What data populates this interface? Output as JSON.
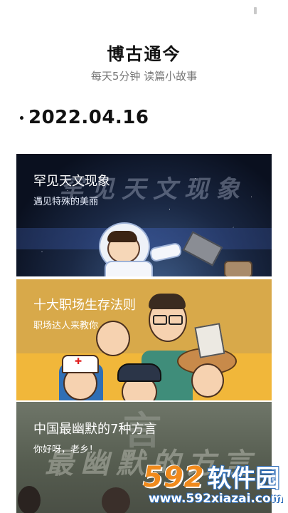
{
  "header": {
    "title": "博古通今",
    "subtitle": "每天5分钟 读篇小故事"
  },
  "date": "2022.04.16",
  "cards": [
    {
      "title": "罕见天文现象",
      "subtitle": "遇见特殊的美丽",
      "bg_text": "罕见天文现象",
      "color": "#1a2844"
    },
    {
      "title": "十大职场生存法则",
      "subtitle": "职场达人来教你",
      "color": "#d8a94a"
    },
    {
      "title": "中国最幽默的7种方言",
      "subtitle": "你好呀，老乡！",
      "bg_text": "最幽默的方言",
      "big_char": "言",
      "color": "#565d50"
    }
  ],
  "watermark": {
    "number": "592",
    "name": "软件园",
    "url": "www.592xiazai.com"
  }
}
